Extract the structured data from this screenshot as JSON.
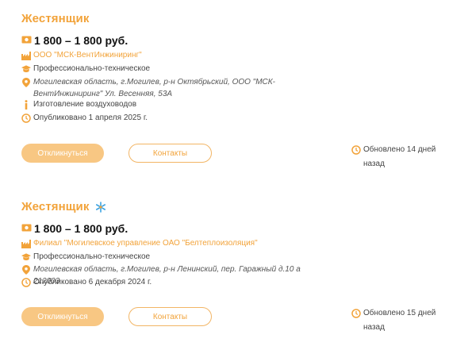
{
  "vacancies": [
    {
      "title": "Жестянщик",
      "salary": "1 800 – 1 800 руб.",
      "company": "ООО \"МСК-ВентИнжиниринг\"",
      "education": "Профессионально-техническое",
      "address": "Могилевская область, г.Могилев, р-н Октябрьский, ООО \"МСК-ВентИнжиниринг\" Ул. Весенняя, 53А",
      "description": "Изготовление воздуховодов",
      "published": "Опубликовано 1 апреля 2025 г.",
      "apply_label": "Откликнуться",
      "contacts_label": "Контакты",
      "updated": "Обновлено 14 дней назад"
    },
    {
      "title": "Жестянщик",
      "salary": "1 800 – 1 800 руб.",
      "company": "Филиал \"Могилевское управление ОАО \"Белтеплоизоляция\"",
      "education": "Профессионально-техническое",
      "address": "Могилевская область, г.Могилев, р-н Ленинский, пер. Гаражный д.10 а 212003",
      "published": "Опубликовано 6 декабря 2024 г.",
      "apply_label": "Откликнуться",
      "contacts_label": "Контакты",
      "updated": "Обновлено 15 дней назад"
    }
  ],
  "colors": {
    "accent": "#f2a33a",
    "apply_button": "#f8c783",
    "star": "#3aa3e3"
  },
  "icons": {
    "salary": "money-icon",
    "company": "factory-icon",
    "education": "graduation-cap-icon",
    "address": "location-pin-icon",
    "description": "info-icon",
    "published": "clock-icon",
    "updated": "clock-icon",
    "featured": "star-icon"
  }
}
